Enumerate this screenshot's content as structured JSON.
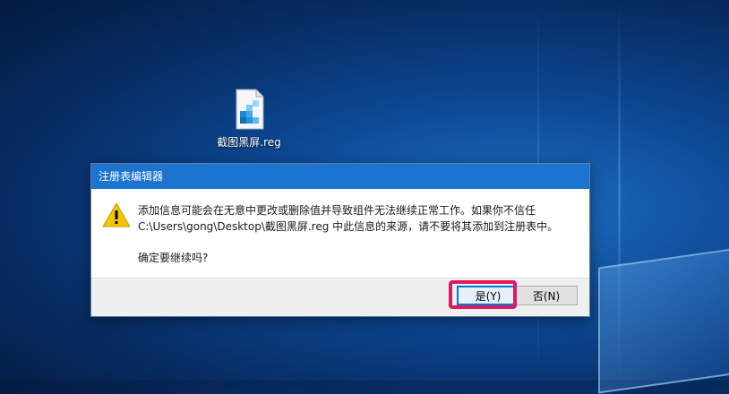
{
  "desktop": {
    "file_icon": {
      "name": "registry-file-icon",
      "label": "截图黑屏.reg"
    }
  },
  "dialog": {
    "title": "注册表编辑器",
    "icon": "warning-icon",
    "message_line1": "添加信息可能会在无意中更改或删除值并导致组件无法继续正常工作。如果你不信任",
    "message_line2": "C:\\Users\\gong\\Desktop\\截图黑屏.reg 中此信息的来源，请不要将其添加到注册表中。",
    "question": "确定要继续吗?",
    "buttons": {
      "yes_label": "是(Y)",
      "no_label": "否(N)"
    },
    "highlight_color": "#e0195c",
    "titlebar_color": "#1a74d0"
  }
}
